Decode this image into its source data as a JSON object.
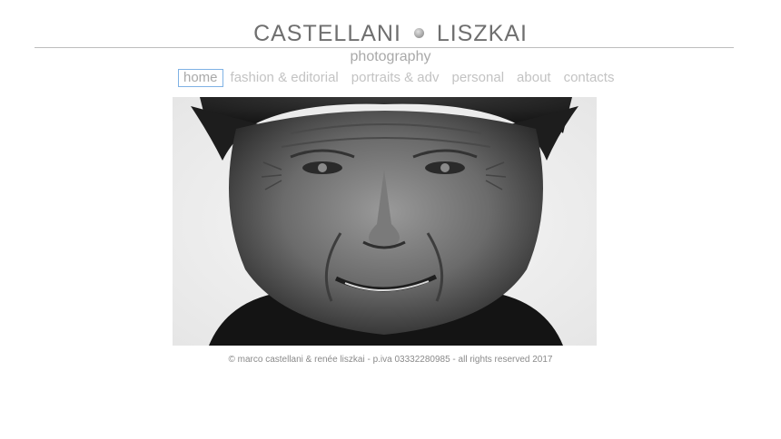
{
  "header": {
    "brand_left": "CASTELLANI",
    "brand_right": "LISZKAI",
    "tagline": "photography"
  },
  "nav": {
    "items": [
      {
        "label": "home",
        "active": true
      },
      {
        "label": "fashion & editorial",
        "active": false
      },
      {
        "label": "portraits & adv",
        "active": false
      },
      {
        "label": "personal",
        "active": false
      },
      {
        "label": "about",
        "active": false
      },
      {
        "label": "contacts",
        "active": false
      }
    ]
  },
  "hero": {
    "image_icon": "portrait-photo",
    "style": "black-and-white"
  },
  "footer": {
    "text": "© marco castellani & renée liszkai - p.iva 03332280985 - all rights reserved 2017"
  },
  "colors": {
    "brand": "#6f6f6f",
    "nav_text": "#c3c3c3",
    "active_border": "#7fb2e5",
    "rule": "#bdbdbd"
  }
}
